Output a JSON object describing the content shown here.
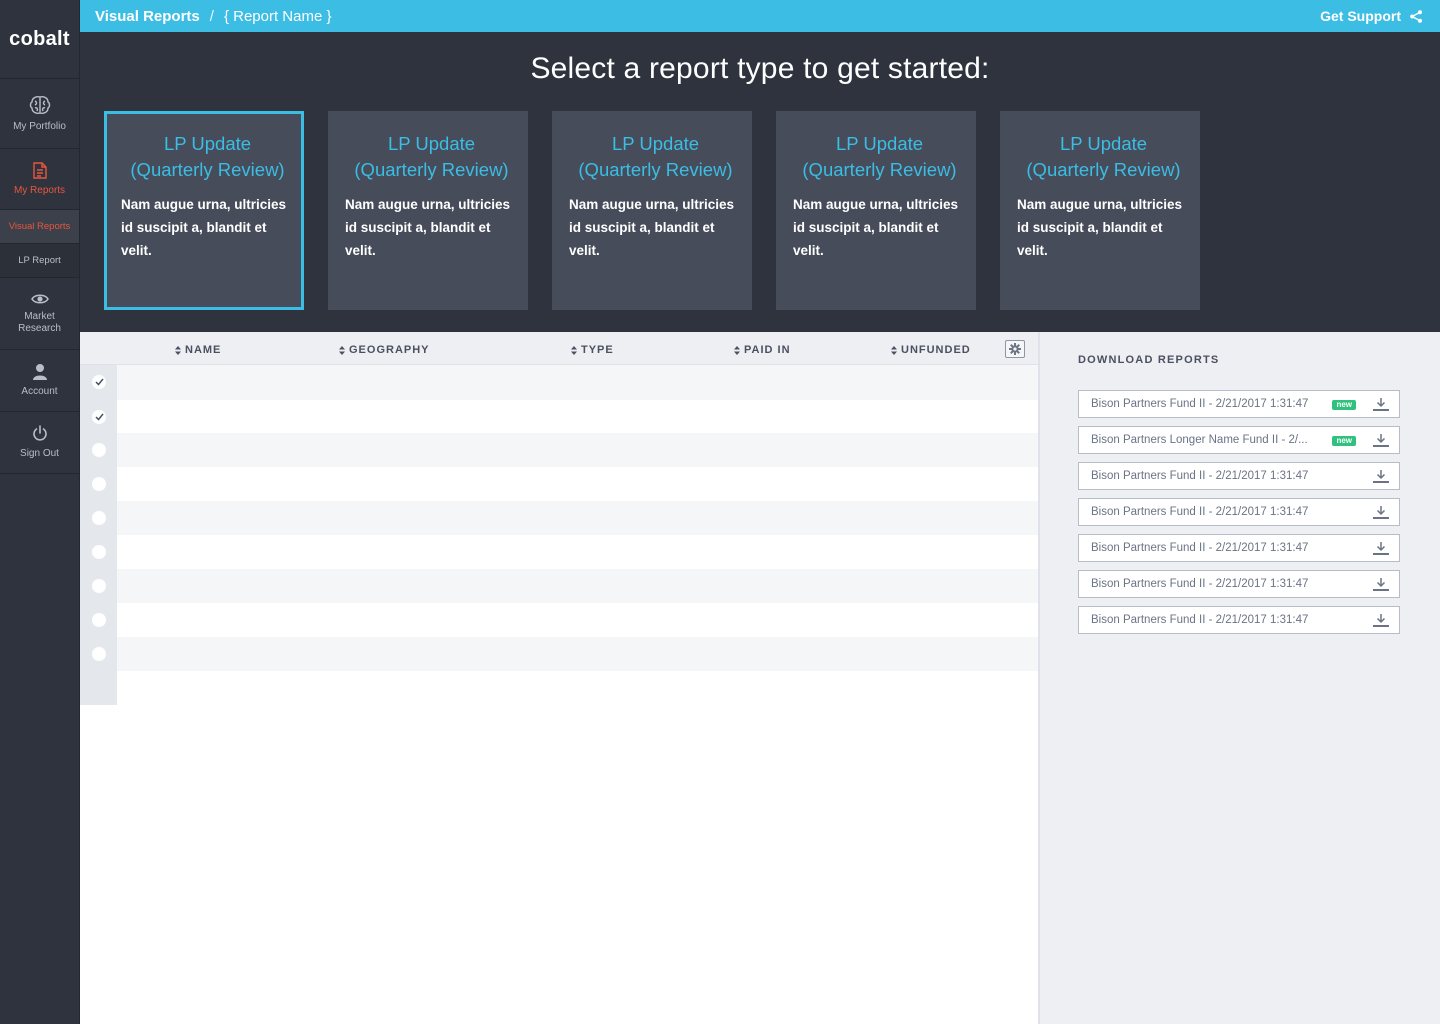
{
  "app": {
    "logo": "cobalt"
  },
  "sidebar": {
    "items": [
      {
        "label": "My Portfolio",
        "icon": "brain-icon"
      },
      {
        "label": "My Reports",
        "icon": "document-icon"
      },
      {
        "label": "Visual Reports"
      },
      {
        "label": "LP Report"
      },
      {
        "label": "Market Research",
        "icon": "eye-icon"
      },
      {
        "label": "Account",
        "icon": "user-icon"
      },
      {
        "label": "Sign Out",
        "icon": "power-icon"
      }
    ]
  },
  "topbar": {
    "breadcrumb": "Visual Reports",
    "separator": "/",
    "current": "{ Report Name }",
    "support": "Get Support"
  },
  "hero": {
    "title": "Select a report type to get started:",
    "cards": [
      {
        "title": "LP Update (Quarterly Review)",
        "desc": "Nam augue urna, ultricies id suscipit a, blandit et velit."
      },
      {
        "title": "LP Update (Quarterly Review)",
        "desc": "Nam augue urna, ultricies id suscipit a, blandit et velit."
      },
      {
        "title": "LP Update (Quarterly Review)",
        "desc": "Nam augue urna, ultricies id suscipit a, blandit et velit."
      },
      {
        "title": "LP Update (Quarterly Review)",
        "desc": "Nam augue urna, ultricies id suscipit a, blandit et velit."
      },
      {
        "title": "LP Update (Quarterly Review)",
        "desc": "Nam augue urna, ultricies id suscipit a, blandit et velit."
      }
    ]
  },
  "table": {
    "columns": [
      "NAME",
      "GEOGRAPHY",
      "TYPE",
      "PAID IN",
      "UNFUNDED"
    ],
    "rows_checked": [
      true,
      true,
      false,
      false,
      false,
      false,
      false,
      false,
      false
    ]
  },
  "downloads": {
    "heading": "DOWNLOAD REPORTS",
    "items": [
      {
        "name": "Bison Partners Fund II - 2/21/2017 1:31:47",
        "badge": "new"
      },
      {
        "name": "Bison Partners Longer Name Fund II - 2/...",
        "badge": "new"
      },
      {
        "name": "Bison Partners Fund II - 2/21/2017 1:31:47"
      },
      {
        "name": "Bison Partners Fund II - 2/21/2017 1:31:47"
      },
      {
        "name": "Bison Partners Fund II - 2/21/2017 1:31:47"
      },
      {
        "name": "Bison Partners Fund II - 2/21/2017 1:31:47"
      },
      {
        "name": "Bison Partners Fund II - 2/21/2017 1:31:47"
      }
    ]
  },
  "colors": {
    "accent": "#3bbde4",
    "active": "#e8573f",
    "sidebar": "#2e333d",
    "card": "#464c5a",
    "badge": "#2ec27e"
  }
}
